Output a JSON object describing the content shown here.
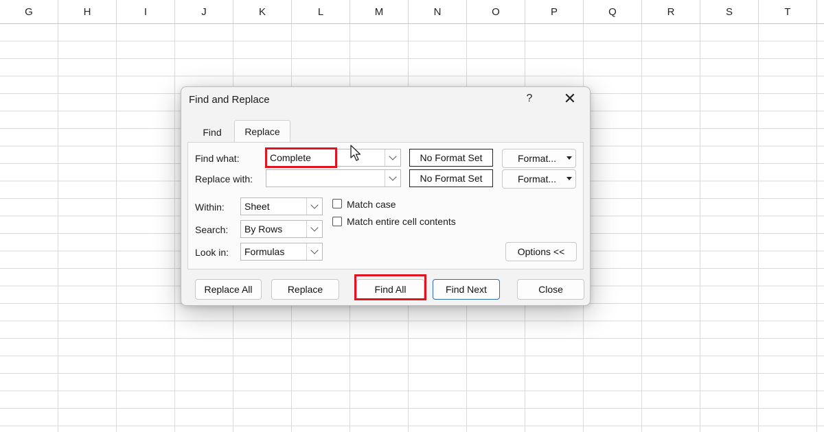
{
  "columns": [
    "G",
    "H",
    "I",
    "J",
    "K",
    "L",
    "M",
    "N",
    "O",
    "P",
    "Q",
    "R",
    "S",
    "T"
  ],
  "dialog": {
    "title": "Find and Replace",
    "help_label": "?",
    "close_label": "✕",
    "tabs": [
      {
        "label": "Find",
        "active": false
      },
      {
        "label": "Replace",
        "active": true
      }
    ],
    "find_what": {
      "label": "Find what:",
      "value": "Complete"
    },
    "replace_with": {
      "label": "Replace with:",
      "value": ""
    },
    "format_status_1": "No Format Set",
    "format_status_2": "No Format Set",
    "format_button_1": "Format...",
    "format_button_2": "Format...",
    "within": {
      "label": "Within:",
      "value": "Sheet"
    },
    "search": {
      "label": "Search:",
      "value": "By Rows"
    },
    "look_in": {
      "label": "Look in:",
      "value": "Formulas"
    },
    "match_case": {
      "label": "Match case",
      "checked": false
    },
    "match_entire": {
      "label": "Match entire cell contents",
      "checked": false
    },
    "options_button": "Options <<",
    "buttons": {
      "replace_all": "Replace All",
      "replace": "Replace",
      "find_all": "Find All",
      "find_next": "Find Next",
      "close": "Close"
    }
  },
  "highlight_color": "#e0141e"
}
